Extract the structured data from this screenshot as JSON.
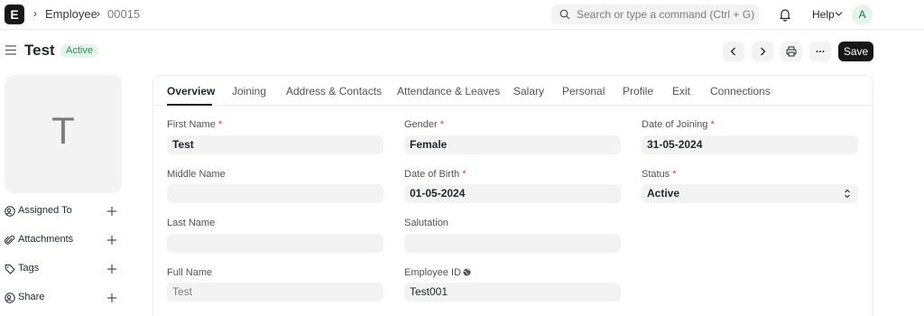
{
  "navbar": {
    "logo": "E",
    "breadcrumbs": [
      "Employee",
      "00015"
    ],
    "search_placeholder": "Search or type a command (Ctrl + G)",
    "help_label": "Help",
    "avatar_initial": "A"
  },
  "header": {
    "title": "Test",
    "status": "Active",
    "save_label": "Save"
  },
  "sidebar": {
    "image_initial": "T",
    "items": [
      {
        "label": "Assigned To",
        "icon": "user-add-icon"
      },
      {
        "label": "Attachments",
        "icon": "paperclip-icon"
      },
      {
        "label": "Tags",
        "icon": "tag-icon"
      },
      {
        "label": "Share",
        "icon": "share-icon"
      }
    ]
  },
  "tabs": [
    "Overview",
    "Joining",
    "Address & Contacts",
    "Attendance & Leaves",
    "Salary",
    "Personal",
    "Profile",
    "Exit",
    "Connections"
  ],
  "active_tab": "Overview",
  "form": {
    "first_name": {
      "label": "First Name",
      "value": "Test"
    },
    "middle_name": {
      "label": "Middle Name",
      "value": ""
    },
    "last_name": {
      "label": "Last Name",
      "value": ""
    },
    "full_name": {
      "label": "Full Name",
      "value": "Test"
    },
    "gender": {
      "label": "Gender",
      "value": "Female"
    },
    "date_of_birth": {
      "label": "Date of Birth",
      "value": "01-05-2024"
    },
    "salutation": {
      "label": "Salutation",
      "value": ""
    },
    "employee_id": {
      "label": "Employee ID",
      "value": "Test001"
    },
    "date_of_joining": {
      "label": "Date of Joining",
      "value": "31-05-2024"
    },
    "status": {
      "label": "Status",
      "value": "Active"
    }
  },
  "required_marker": "*",
  "colors": {
    "accent": "#171717",
    "status_green_bg": "#e4f5e9",
    "status_green_text": "#278f5e",
    "required": "#e03636"
  }
}
